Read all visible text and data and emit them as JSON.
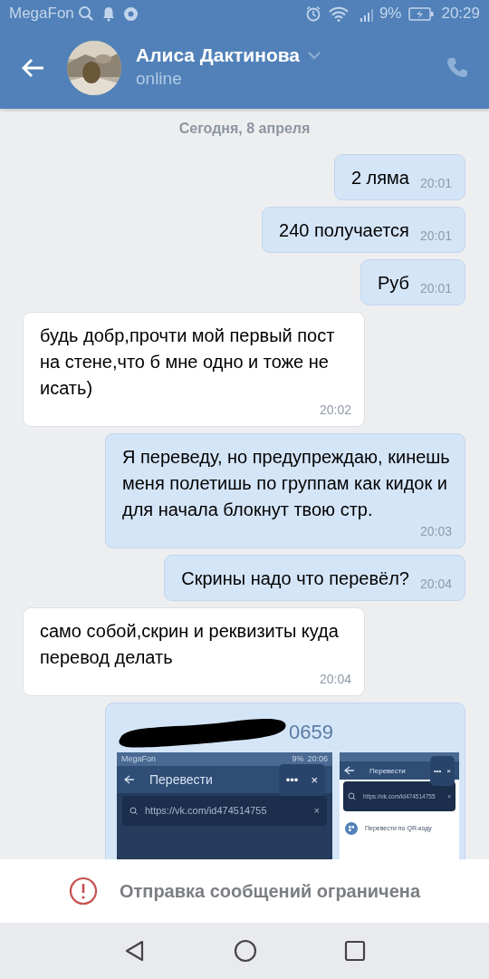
{
  "status_bar": {
    "carrier": "MegaFon",
    "battery": "9%",
    "time": "20:29"
  },
  "header": {
    "name": "Алиса Дактинова",
    "status": "online"
  },
  "date": "Сегодня, 8 апреля",
  "messages": [
    {
      "kind": "text",
      "outgoing": true,
      "text": "2 ляма",
      "time": "20:01"
    },
    {
      "kind": "text",
      "outgoing": true,
      "text": "240 получается",
      "time": "20:01"
    },
    {
      "kind": "text",
      "outgoing": true,
      "text": "Руб",
      "time": "20:01"
    },
    {
      "kind": "text",
      "outgoing": false,
      "text": "будь добр,прочти мой первый пост на стене,что б мне одно и тоже не исать)",
      "time": "20:02"
    },
    {
      "kind": "text",
      "outgoing": true,
      "text": "Я переведу, но предупреждаю, кинешь меня полетишь по группам как кидок и для начала блокнут твою стр.",
      "time": "20:03"
    },
    {
      "kind": "text",
      "outgoing": true,
      "text": "Скрины надо что перевёл?",
      "time": "20:04"
    },
    {
      "kind": "text",
      "outgoing": false,
      "text": "само собой,скрин и реквизиты куда перевод делать",
      "time": "20:04"
    },
    {
      "kind": "attachment",
      "outgoing": true,
      "redacted": true,
      "text": "0659",
      "screenshots": [
        {
          "kind": "large",
          "carrier": "MegaFon",
          "battery": "9%",
          "time": "20:06",
          "title": "Перевести",
          "menu": "•••",
          "close": "×",
          "url": "https://vk.com/id474514755",
          "clear": "×"
        },
        {
          "kind": "small",
          "title": "Перевести",
          "menu": "•••",
          "close": "×",
          "url": "https://vk.com/id474514755",
          "clear": "×",
          "item": "Перевести по QR-коду"
        }
      ]
    }
  ],
  "notice": "Отправка сообщений ограничена"
}
